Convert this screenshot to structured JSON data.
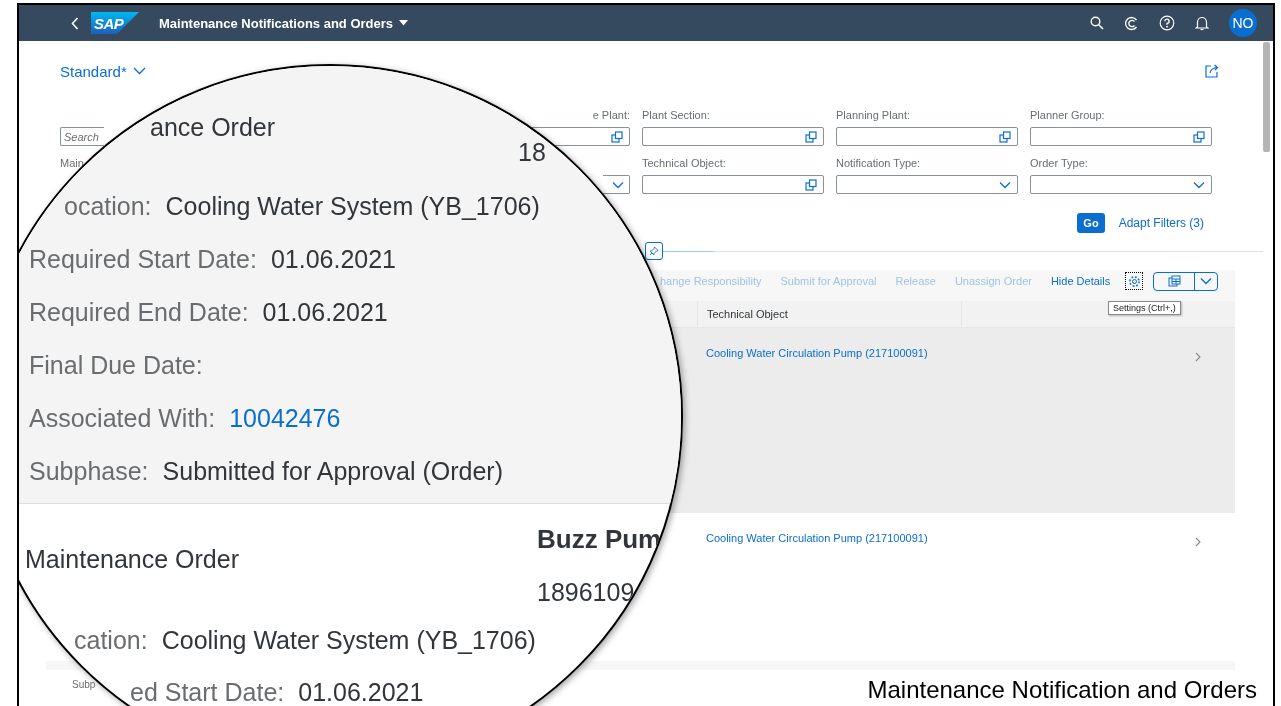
{
  "shell": {
    "logo_text": "SAP",
    "title": "Maintenance Notifications and Orders",
    "avatar": "NO"
  },
  "variant": "Standard*",
  "filters": [
    {
      "kind": "search",
      "placeholder": "Search"
    },
    {
      "kind": "value_help",
      "label": "e Plant:"
    },
    {
      "kind": "value_help",
      "label": "Plant Section:"
    },
    {
      "kind": "value_help",
      "label": "Planning Plant:"
    },
    {
      "kind": "value_help",
      "label": "Planner Group:"
    },
    {
      "kind": "label_only",
      "label": "Main"
    },
    {
      "kind": "dropdown"
    },
    {
      "kind": "value_help",
      "label": "Technical Object:"
    },
    {
      "kind": "dropdown",
      "label": "Notification Type:"
    },
    {
      "kind": "dropdown",
      "label": "Order Type:"
    }
  ],
  "go_button": "Go",
  "adapt_filters": "Adapt Filters (3)",
  "toolbar": [
    {
      "label": "hange Responsibility",
      "disabled": true
    },
    {
      "label": "Submit for Approval",
      "disabled": true
    },
    {
      "label": "Release",
      "disabled": true
    },
    {
      "label": "Unassign Order",
      "disabled": true
    },
    {
      "label": "Hide Details",
      "disabled": false
    }
  ],
  "tooltip": "Settings (Ctrl+,)",
  "table": {
    "columns": [
      "Technical Object"
    ],
    "rows": [
      {
        "technical_object": "Cooling Water Circulation Pump (217100091)",
        "selected": true
      },
      {
        "technical_object": "Cooling Water Circulation Pump (217100091)",
        "selected": false,
        "column_1": "Subp"
      }
    ]
  },
  "magnifier": {
    "title": "ance Order",
    "number": "18",
    "fields": [
      {
        "label": "ocation:",
        "value": "Cooling Water System (YB_1706)",
        "kind": "text"
      },
      {
        "label": "Required Start Date:",
        "value": "01.06.2021",
        "kind": "text"
      },
      {
        "label": "Required End Date:",
        "value": "01.06.2021",
        "kind": "text"
      },
      {
        "label": "Final Due Date:"
      },
      {
        "label": "Associated With:",
        "value": "10042476",
        "kind": "link"
      },
      {
        "label": "Subphase:",
        "value": "Submitted for Approval (Order)",
        "kind": "text"
      }
    ],
    "next": {
      "type": "Maintenance Order",
      "title": "Buzz Pum",
      "number": "1896109",
      "fields": [
        {
          "label": "cation:",
          "value": "Cooling Water System (YB_1706)",
          "kind": "text"
        },
        {
          "label": "ed Start Date:",
          "value": "01.06.2021",
          "kind": "text"
        }
      ]
    }
  },
  "caption": "Maintenance Notification and Orders"
}
